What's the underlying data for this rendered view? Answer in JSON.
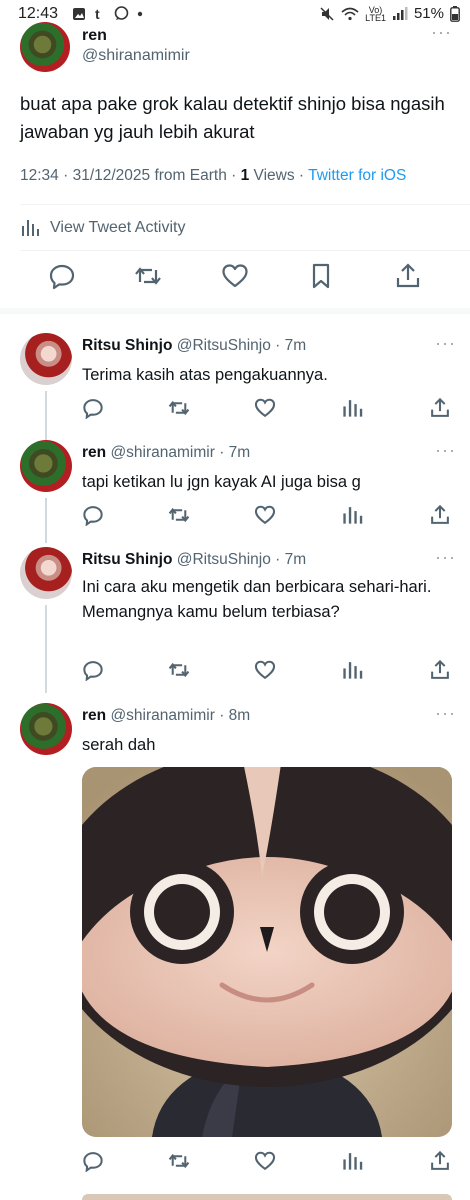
{
  "status_bar": {
    "time": "12:43",
    "network_label_top": "Vo)",
    "network_label_bottom": "LTE1",
    "battery": "51%"
  },
  "main_tweet": {
    "author_name": "ren",
    "author_handle": "@shiranamimir",
    "text": "buat apa pake grok kalau detektif shinjo bisa ngasih jawaban yg jauh lebih akurat",
    "time": "12:34",
    "date": "31/12/2025",
    "location": "from Earth",
    "views_count": "1",
    "views_label": "Views",
    "client": "Twitter for iOS",
    "activity_label": "View Tweet Activity"
  },
  "replies": [
    {
      "name": "Ritsu Shinjo",
      "handle": "@RitsuShinjo",
      "age": "7m",
      "text": "Terima kasih atas pengakuannya."
    },
    {
      "name": "ren",
      "handle": "@shiranamimir",
      "age": "7m",
      "text": "tapi ketikan lu jgn kayak AI juga bisa g"
    },
    {
      "name": "Ritsu Shinjo",
      "handle": "@RitsuShinjo",
      "age": "7m",
      "text": "Ini cara aku mengetik dan berbicara sehari-hari. Memangnya kamu belum terbiasa?"
    },
    {
      "name": "ren",
      "handle": "@shiranamimir",
      "age": "8m",
      "text": "serah dah"
    }
  ],
  "separators": {
    "dot": " · "
  },
  "colors": {
    "accent": "#1d9bf0",
    "secondary_text": "#536471",
    "primary_text": "#0f1419",
    "thread_line": "#cfd9de"
  },
  "icons": [
    "reply-icon",
    "retweet-icon",
    "like-icon",
    "bookmark-icon",
    "views-icon",
    "share-icon",
    "more-icon"
  ]
}
